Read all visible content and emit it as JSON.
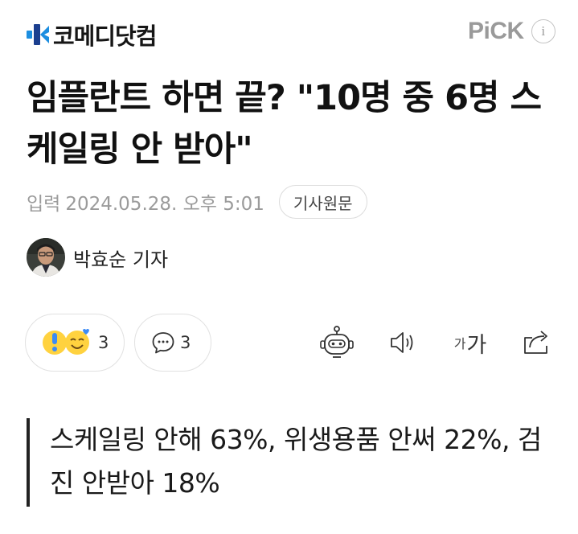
{
  "header": {
    "logo_text": "코메디닷컴",
    "pick_label": "PiCK",
    "pick_info": "i"
  },
  "article": {
    "title": "임플란트 하면 끝? \"10명 중 6명 스케일링 안 받아\"",
    "date_label": "입력",
    "date_value": "2024.05.28. 오후 5:01",
    "original_button": "기사원문",
    "reporter": "박효순 기자",
    "subtitle": "스케일링 안해 63%, 위생용품 안써 22%, 검진 안받아 18%"
  },
  "actions": {
    "reaction_count": "3",
    "comment_count": "3",
    "font_small": "가",
    "font_large": "가",
    "icons": [
      "reaction-icons",
      "comment-icon",
      "robot-icon",
      "speaker-icon",
      "font-size-icon",
      "share-icon"
    ]
  },
  "colors": {
    "logo_blue": "#1c8ee0",
    "logo_navy": "#1b3f8f",
    "muted_gray": "#9b9b9b",
    "border_gray": "#e1e1e1",
    "reaction_yellow": "#ffd23f",
    "reaction_blue": "#3d8bf5"
  }
}
